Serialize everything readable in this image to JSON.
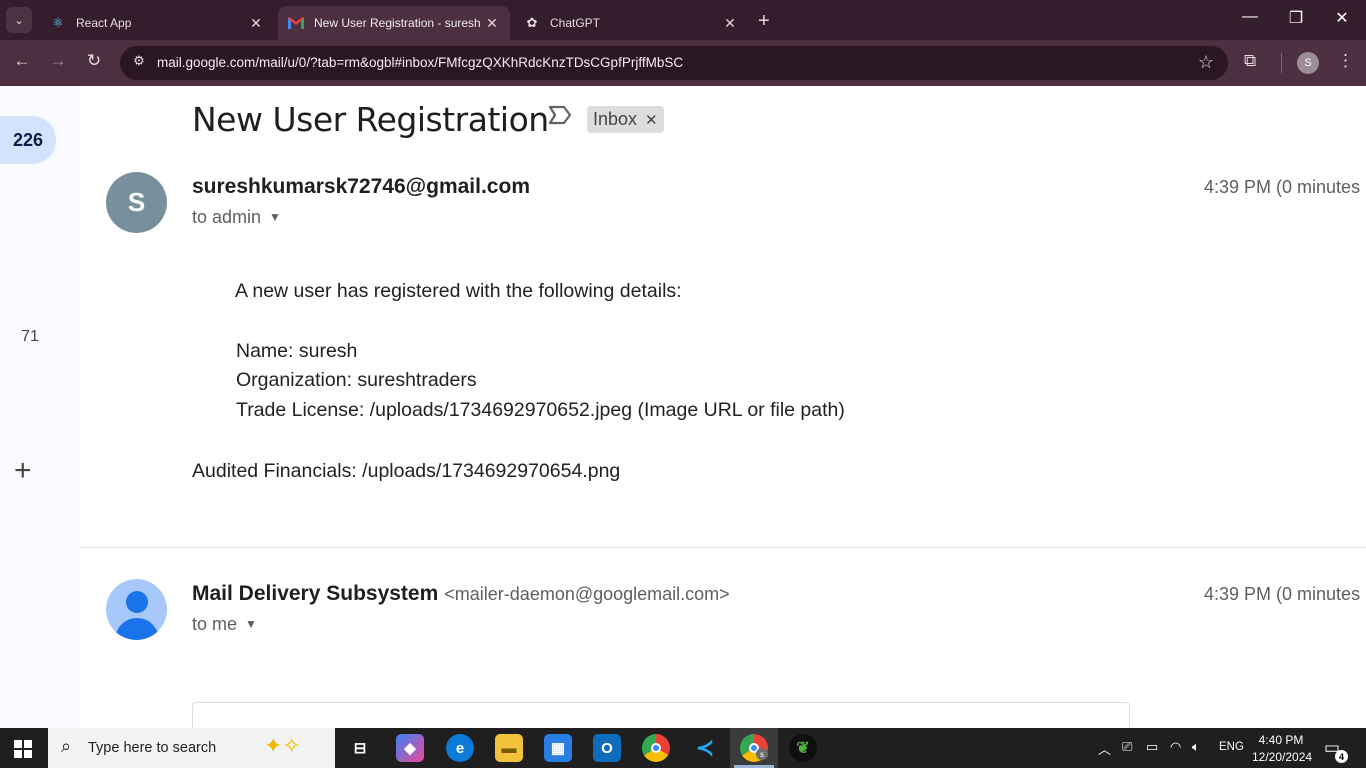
{
  "browser": {
    "tabs": [
      {
        "title": "React App",
        "icon": "react-icon"
      },
      {
        "title": "New User Registration - suresh",
        "icon": "gmail-icon"
      },
      {
        "title": "ChatGPT",
        "icon": "chatgpt-icon"
      }
    ],
    "url": "mail.google.com/mail/u/0/?tab=rm&ogbl#inbox/FMfcgzQXKhRdcKnzTDsCGpfPrjffMbSC",
    "profile_initial": "S"
  },
  "rail": {
    "unread_count": "226",
    "secondary_count": "71"
  },
  "email": {
    "subject": "New User Registration",
    "label_chip": "Inbox",
    "messages": [
      {
        "avatar_initial": "S",
        "sender": "sureshkumarsk72746@gmail.com",
        "sender_address": "",
        "to": "to admin",
        "time": "4:39 PM (0 minutes",
        "body": [
          "A new user has registered with the following details:",
          "Name: suresh",
          "Organization: sureshtraders",
          "Trade License: /uploads/1734692970652.jpeg (Image URL or file path)",
          "Audited Financials: /uploads/1734692970654.png"
        ]
      },
      {
        "sender": "Mail Delivery Subsystem",
        "sender_address": "<mailer-daemon@googlemail.com>",
        "to": "to me",
        "time": "4:39 PM (0 minutes"
      }
    ]
  },
  "taskbar": {
    "search_placeholder": "Type here to search",
    "language": "ENG",
    "time": "4:40 PM",
    "date": "12/20/2024",
    "notification_count": "4",
    "chrome_badge": "s"
  }
}
